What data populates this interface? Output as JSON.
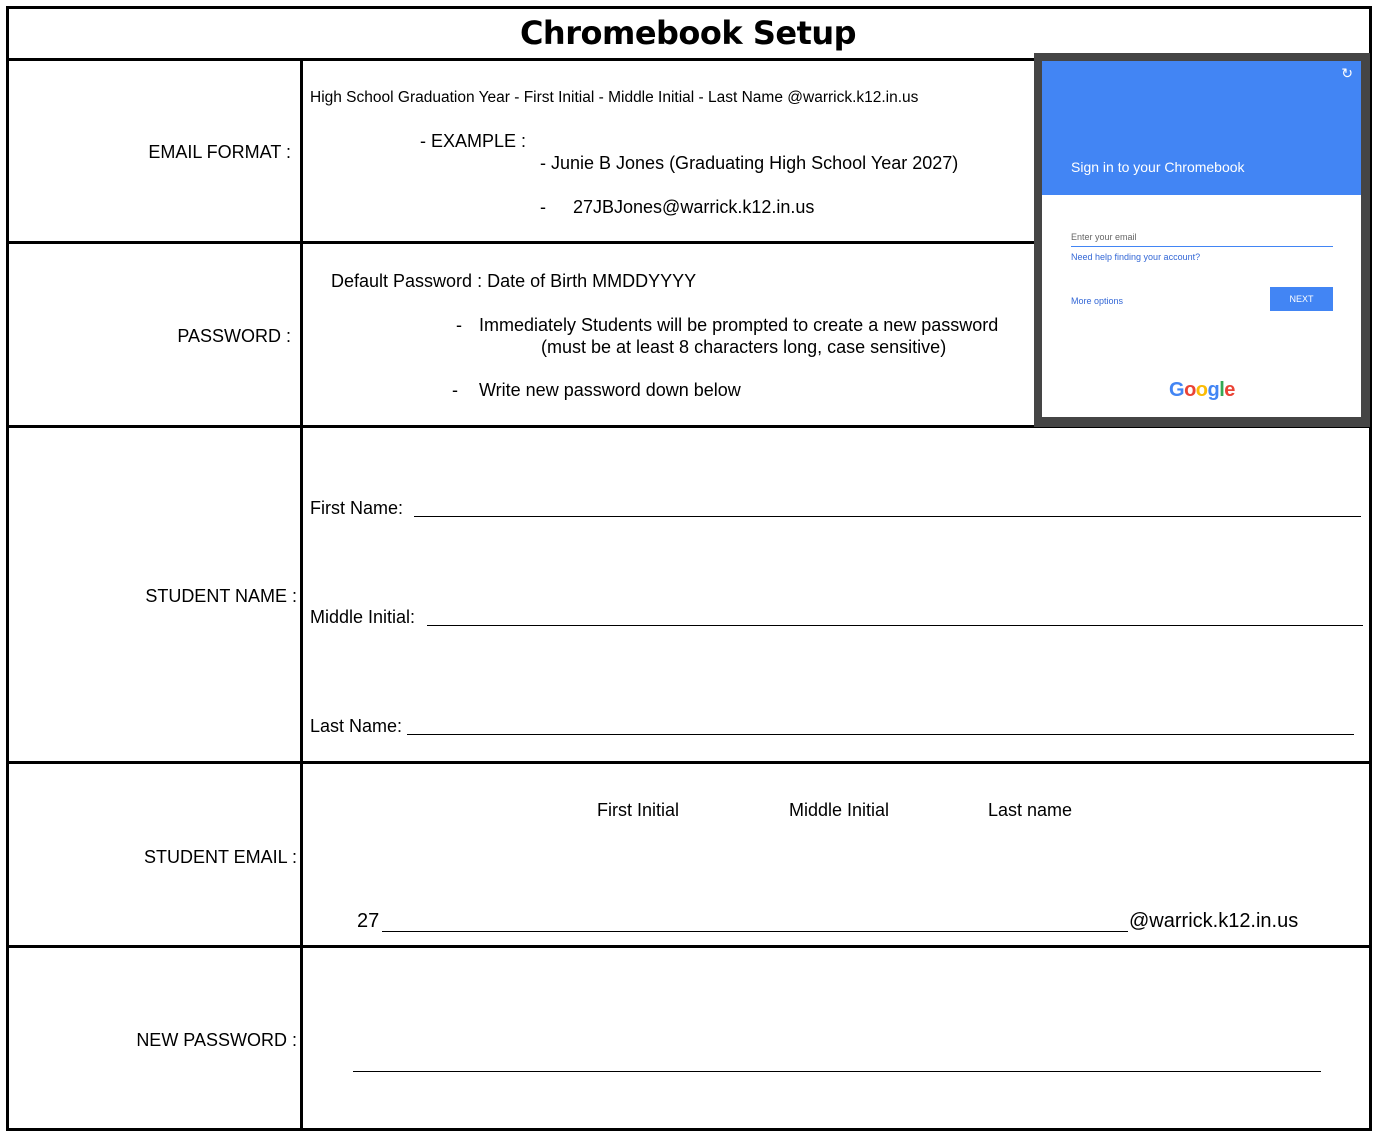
{
  "title": "Chromebook Setup",
  "email_format": {
    "label": "EMAIL FORMAT :",
    "format_line": "High School Graduation Year  -  First Initial - Middle Initial - Last Name @warrick.k12.in.us",
    "example_label": "-  EXAMPLE :",
    "example_name": "- Junie B Jones (Graduating High School Year 2027)",
    "example_dash": "-",
    "example_email": "27JBJones@warrick.k12.in.us"
  },
  "password": {
    "label": "PASSWORD :",
    "default_line": "Default Password :  Date of Birth    MMDDYYYY",
    "bullet": "-",
    "prompt_line1": "Immediately Students will be prompted to create a new password",
    "prompt_line2": "(must be at least 8 characters long, case sensitive)",
    "write_line": "Write new password down below"
  },
  "student_name": {
    "label": "STUDENT NAME :",
    "first": "First Name:",
    "middle": "Middle Initial:",
    "last": "Last Name:"
  },
  "student_email": {
    "label": "STUDENT EMAIL :",
    "col_first": "First Initial",
    "col_middle": "Middle Initial",
    "col_last": "Last name",
    "prefix": "27",
    "domain": "@warrick.k12.in.us"
  },
  "new_password": {
    "label": "NEW PASSWORD :"
  },
  "screenshot": {
    "heading": "Sign in to your Chromebook",
    "placeholder": "Enter your email",
    "help_link": "Need help finding your account?",
    "more_options": "More options",
    "next_button": "NEXT",
    "logo": "Google",
    "refresh_icon": "refresh-icon",
    "header_color": "#4285f4"
  }
}
